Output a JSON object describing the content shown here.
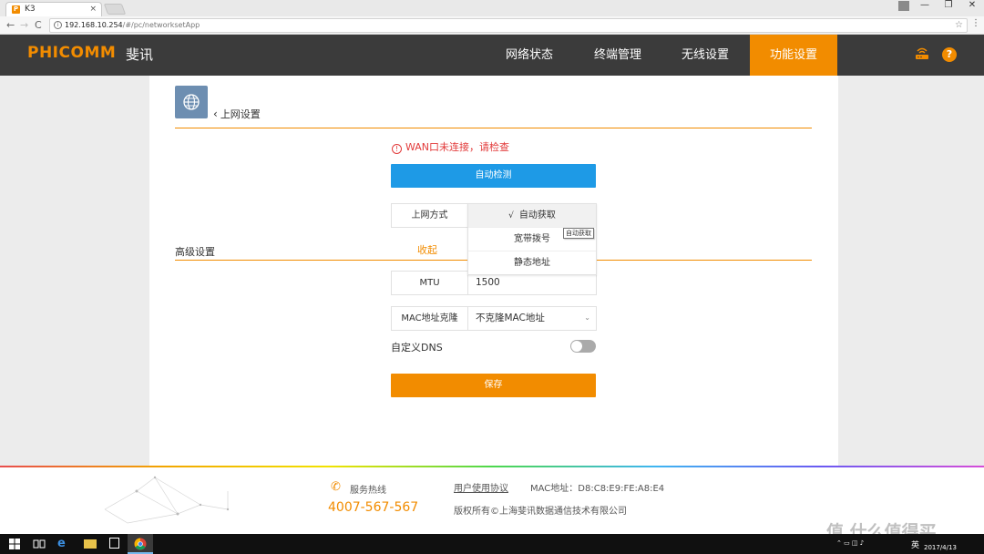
{
  "browser": {
    "tab_title": "K3",
    "tab_favicon": "P",
    "tab_close": "×",
    "url_host": "192.168.10.254",
    "url_path": "/#/pc/networksetApp",
    "back": "←",
    "forward": "→",
    "reload": "C",
    "star": "☆",
    "menu": "⋮",
    "minimize": "—",
    "maximize": "❐",
    "close": "✕"
  },
  "header": {
    "logo": "PHICOMM",
    "logo_cn": "斐讯",
    "nav": [
      {
        "label": "网络状态"
      },
      {
        "label": "终端管理"
      },
      {
        "label": "无线设置"
      },
      {
        "label": "功能设置",
        "active": true
      }
    ],
    "help": "?"
  },
  "page": {
    "back_label": "上网设置",
    "warning": "WAN口未连接，请检查",
    "warning_icon": "!",
    "detect_button": "自动检测",
    "connection_label": "上网方式",
    "dropdown": {
      "check": "√",
      "options": [
        "自动获取",
        "宽带拨号",
        "静态地址"
      ],
      "selected": "自动获取"
    },
    "tooltip": "自动获取",
    "advanced": "高级设置",
    "collapse": "收起",
    "mtu_label": "MTU",
    "mtu_value": "1500",
    "mac_clone_label": "MAC地址克隆",
    "mac_clone_value": "不克隆MAC地址",
    "custom_dns_label": "自定义DNS",
    "custom_dns_enabled": false,
    "save_button": "保存"
  },
  "footer": {
    "hotline_label": "服务热线",
    "hotline": "4007-567-567",
    "agreement": "用户使用协议",
    "mac": "MAC地址：D8:C8:E9:FE:A8:E4",
    "copyright": "版权所有©上海斐讯数据通信技术有限公司",
    "watermark": "值 什么值得买"
  },
  "taskbar": {
    "ime": "英",
    "date": "2017/4/13"
  },
  "colors": {
    "accent": "#f28c00",
    "header_bg": "#3b3b3b",
    "primary_button": "#1e9ae6",
    "warning": "#e23b3b"
  }
}
